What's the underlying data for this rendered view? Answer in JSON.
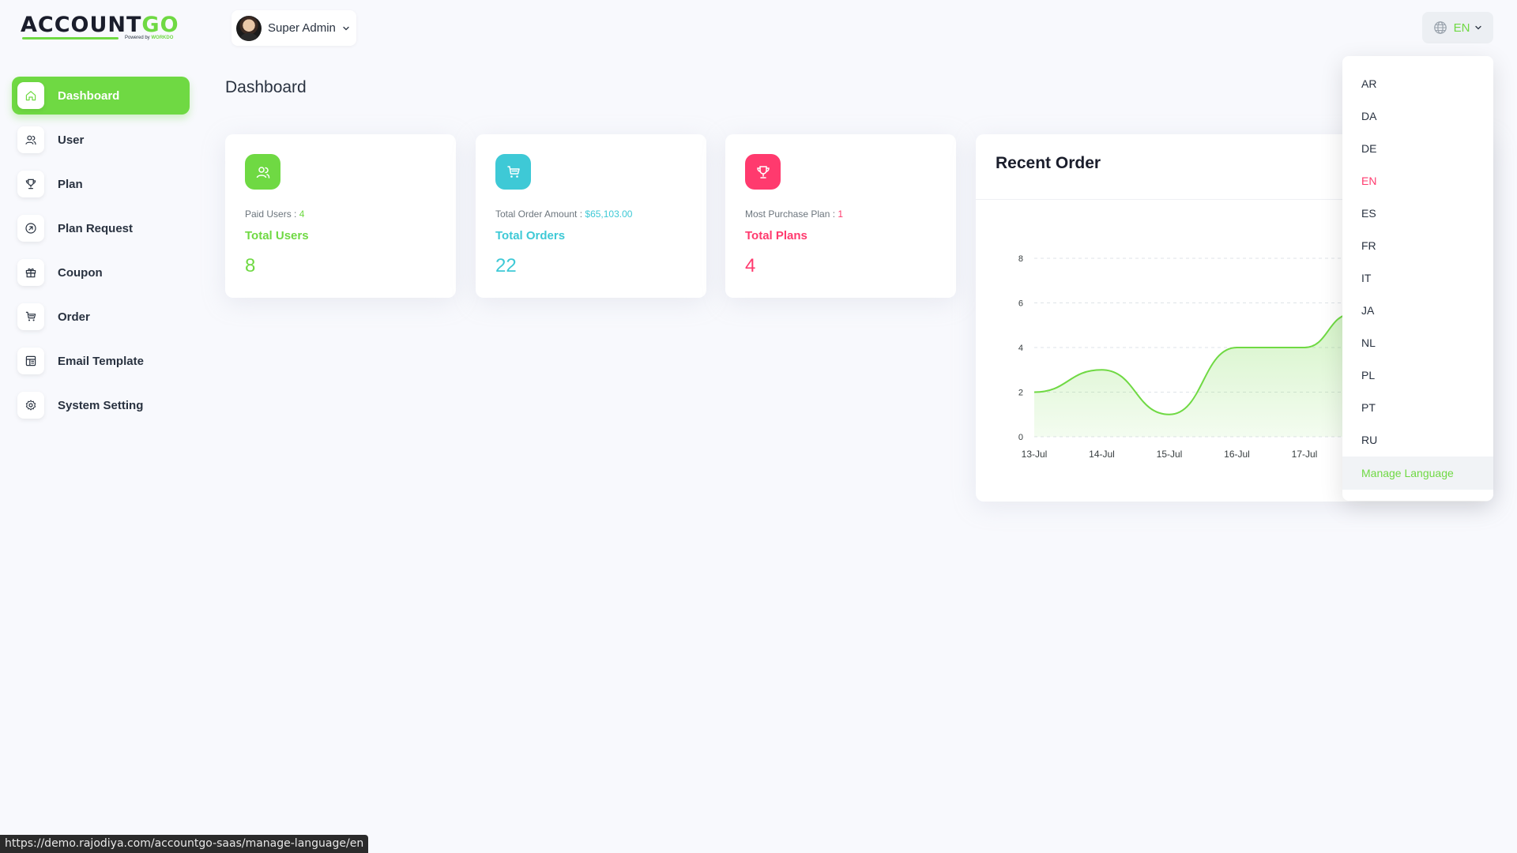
{
  "brand": {
    "logo_main": "ACCOUNT",
    "logo_accent": "GO",
    "logo_sub_prefix": "Powered by ",
    "logo_sub_brand": "WORKDO"
  },
  "header": {
    "user_name": "Super Admin",
    "language_code": "EN"
  },
  "sidebar": {
    "items": [
      {
        "label": "Dashboard",
        "icon": "home-icon",
        "active": true
      },
      {
        "label": "User",
        "icon": "users-icon",
        "active": false
      },
      {
        "label": "Plan",
        "icon": "trophy-icon",
        "active": false
      },
      {
        "label": "Plan Request",
        "icon": "arrow-up-right-circle-icon",
        "active": false
      },
      {
        "label": "Coupon",
        "icon": "gift-icon",
        "active": false
      },
      {
        "label": "Order",
        "icon": "cart-icon",
        "active": false
      },
      {
        "label": "Email Template",
        "icon": "template-icon",
        "active": false
      },
      {
        "label": "System Setting",
        "icon": "gear-icon",
        "active": false
      }
    ]
  },
  "page": {
    "title": "Dashboard"
  },
  "stats": [
    {
      "line_label": "Paid Users : ",
      "line_value": "4",
      "title": "Total Users",
      "value": "8",
      "color": "#6fd943",
      "icon": "users-icon"
    },
    {
      "line_label": "Total Order Amount : ",
      "line_value": "$65,103.00",
      "title": "Total Orders",
      "value": "22",
      "color": "#3ec9d6",
      "icon": "cart-icon"
    },
    {
      "line_label": "Most Purchase Plan : ",
      "line_value": "1",
      "title": "Total Plans",
      "value": "4",
      "color": "#ff3a6e",
      "icon": "trophy-icon"
    }
  ],
  "recent_order": {
    "title": "Recent Order"
  },
  "chart_data": {
    "type": "area",
    "title": "Recent Order",
    "categories": [
      "13-Jul",
      "14-Jul",
      "15-Jul",
      "16-Jul",
      "17-Jul"
    ],
    "series": [
      {
        "values": [
          2,
          3,
          1,
          4,
          4
        ]
      }
    ],
    "ylim": [
      0,
      8
    ],
    "yticks": [
      0,
      2,
      4,
      6,
      8
    ],
    "grid": true,
    "color": "#6fd943",
    "note_visible_continuation": "line rises past 17-Jul, clipped by dropdown"
  },
  "language_dropdown": {
    "options": [
      "AR",
      "DA",
      "DE",
      "EN",
      "ES",
      "FR",
      "IT",
      "JA",
      "NL",
      "PL",
      "PT",
      "RU"
    ],
    "selected": "EN",
    "manage_label": "Manage Language"
  },
  "statusbar": {
    "url": "https://demo.rajodiya.com/accountgo-saas/manage-language/en"
  },
  "colors": {
    "accent": "#6fd943",
    "info": "#3ec9d6",
    "danger": "#ff3a6e"
  }
}
